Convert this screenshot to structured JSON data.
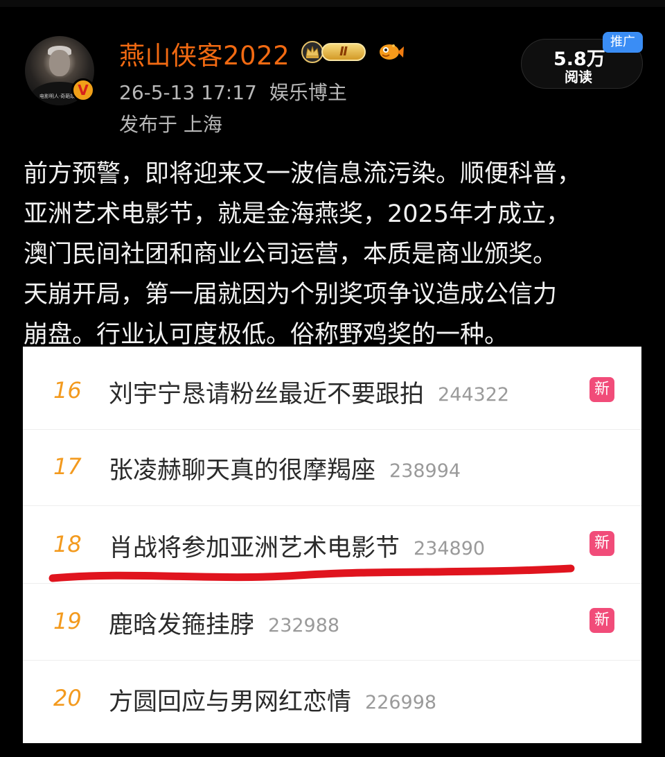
{
  "author": {
    "name": "燕山侠客2022",
    "level_badge": "Ⅱ",
    "avatar_caption": "电影明人·奇葩故事",
    "verified_mark": "V",
    "date": "26-5-13 17:17",
    "role": "娱乐博主",
    "location": "发布于 上海"
  },
  "stats": {
    "reads_count": "5.8万",
    "reads_label": "阅读",
    "promo_tag": "推广"
  },
  "post": {
    "lines": [
      "前方预警，即将迎来又一波信息流污染。顺便科普，",
      "亚洲艺术电影节，就是金海燕奖，2025年才成立，",
      "澳门民间社团和商业公司运营，本质是商业颁奖。",
      "天崩开局，第一届就因为个别奖项争议造成公信力",
      "崩盘。行业认可度极低。俗称野鸡奖的一种。"
    ]
  },
  "hot_list": {
    "rows": [
      {
        "rank": "16",
        "topic": "刘宇宁恳请粉丝最近不要跟拍",
        "heat": "244322",
        "badge": "新"
      },
      {
        "rank": "17",
        "topic": "张凌赫聊天真的很摩羯座",
        "heat": "238994",
        "badge": ""
      },
      {
        "rank": "18",
        "topic": "肖战将参加亚洲艺术电影节",
        "heat": "234890",
        "badge": "新"
      },
      {
        "rank": "19",
        "topic": "鹿晗发箍挂脖",
        "heat": "232988",
        "badge": "新"
      },
      {
        "rank": "20",
        "topic": "方圆回应与男网红恋情",
        "heat": "226998",
        "badge": ""
      }
    ],
    "highlight_color": "#e0141e",
    "rank_color": "#f39a1e",
    "badge_color": "#f14c79"
  },
  "colors": {
    "username": "#f26a12",
    "promo": "#3a8df5",
    "background": "#000000"
  }
}
